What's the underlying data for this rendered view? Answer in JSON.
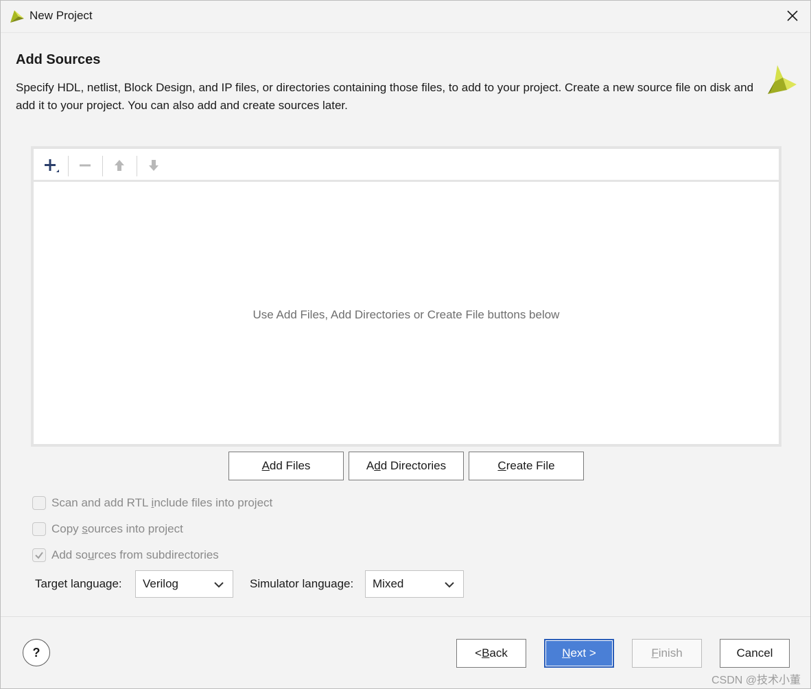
{
  "window": {
    "title": "New Project"
  },
  "header": {
    "title": "Add Sources",
    "description": "Specify HDL, netlist, Block Design, and IP files, or directories containing those files, to add to your project. Create a new source file on disk and add it to your project. You can also add and create sources later."
  },
  "sources_panel": {
    "empty_message": "Use Add Files, Add Directories or Create File buttons below"
  },
  "actions": {
    "add_files": "Add Files",
    "add_directories": "Add Directories",
    "create_file": "Create File"
  },
  "options": {
    "scan_rtl": {
      "label": "Scan and add RTL include files into project",
      "checked": false
    },
    "copy_sources": {
      "label": "Copy sources into project",
      "checked": false
    },
    "add_subdirs": {
      "label": "Add sources from subdirectories",
      "checked": true
    }
  },
  "languages": {
    "target_label": "Target language:",
    "target_value": "Verilog",
    "simulator_label": "Simulator language:",
    "simulator_value": "Mixed"
  },
  "footer": {
    "help": "?",
    "back": "< Back",
    "next": "Next >",
    "finish": "Finish",
    "cancel": "Cancel"
  },
  "watermark": "CSDN @技术小董",
  "colors": {
    "primary_button": "#4a7fd6",
    "logo_light": "#d5e04a",
    "logo_dark": "#7f8a1a"
  }
}
